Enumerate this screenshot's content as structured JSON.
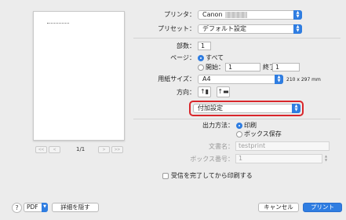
{
  "preview": {
    "page_indicator": "1/1",
    "first_label": "<<",
    "prev_label": "<",
    "next_label": ">",
    "last_label": ">>"
  },
  "printer": {
    "label": "プリンタ：",
    "value": "Canon"
  },
  "preset": {
    "label": "プリセット：",
    "value": "デフォルト設定"
  },
  "copies": {
    "label": "部数：",
    "value": "1"
  },
  "pages": {
    "label": "ページ：",
    "all_label": "すべて",
    "from_label": "開始：",
    "from_value": "1",
    "to_label": "終了：",
    "to_value": "1"
  },
  "paper_size": {
    "label": "用紙サイズ：",
    "value": "A4",
    "dimensions": "210 x 297 mm"
  },
  "orientation": {
    "label": "方向：",
    "portrait_glyph": "↑▮",
    "landscape_glyph": "↑▬"
  },
  "section_popup": {
    "value": "付加設定"
  },
  "output": {
    "label": "出力方法：",
    "print_label": "印刷",
    "box_label": "ボックス保存",
    "docname_label": "文書名：",
    "docname_value": "testprint",
    "boxno_label": "ボックス番号：",
    "boxno_value": "1"
  },
  "confirm_checkbox_label": "受信を完了してから印刷する",
  "bottom": {
    "help": "?",
    "pdf_label": "PDF",
    "hide_details_label": "詳細を隠す",
    "cancel_label": "キャンセル",
    "print_label": "プリント"
  },
  "colors": {
    "accent": "#2f7de1",
    "highlight": "#d9262b"
  }
}
